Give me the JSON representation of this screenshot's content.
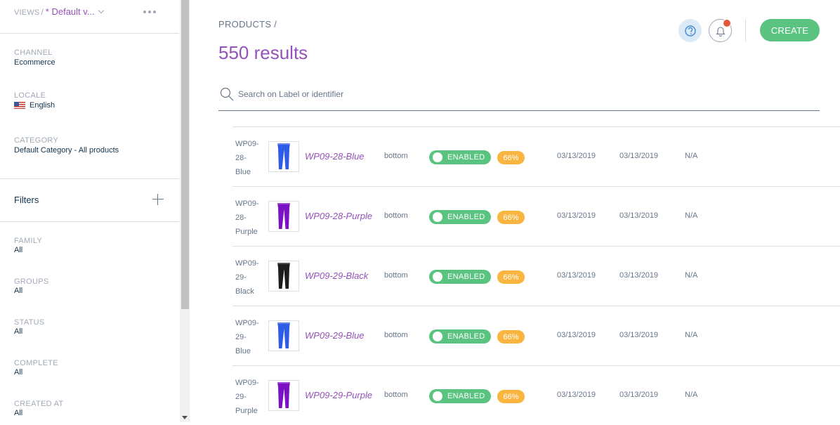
{
  "sidebar": {
    "views": {
      "label": "VIEWS",
      "separator": "/",
      "value": "* Default v..."
    },
    "context": [
      {
        "label": "CHANNEL",
        "value": "Ecommerce"
      },
      {
        "label": "LOCALE",
        "value": "English"
      },
      {
        "label": "CATEGORY",
        "value": "Default Category - All products"
      }
    ],
    "filters_title": "Filters",
    "filters": [
      {
        "label": "FAMILY",
        "value": "All"
      },
      {
        "label": "GROUPS",
        "value": "All"
      },
      {
        "label": "STATUS",
        "value": "All"
      },
      {
        "label": "COMPLETE",
        "value": "All"
      },
      {
        "label": "CREATED AT",
        "value": "All"
      }
    ]
  },
  "header": {
    "breadcrumb": "PRODUCTS /",
    "results": "550 results",
    "create_label": "CREATE"
  },
  "search": {
    "placeholder": "Search on Label or identifier"
  },
  "colors": {
    "accent": "#9452ba",
    "success": "#5ac380",
    "warning": "#f9b53f",
    "alert": "#e0583e"
  },
  "rows": [
    {
      "id_lines": [
        "WP09-",
        "28-",
        "Blue"
      ],
      "label": "WP09-28-Blue",
      "family": "bottom",
      "status": "ENABLED",
      "complete": "66%",
      "created": "03/13/2019",
      "updated": "03/13/2019",
      "variant": "N/A",
      "color": "#2f5ce6"
    },
    {
      "id_lines": [
        "WP09-",
        "28-",
        "Purple"
      ],
      "label": "WP09-28-Purple",
      "family": "bottom",
      "status": "ENABLED",
      "complete": "66%",
      "created": "03/13/2019",
      "updated": "03/13/2019",
      "variant": "N/A",
      "color": "#7a12c4"
    },
    {
      "id_lines": [
        "WP09-",
        "29-",
        "Black"
      ],
      "label": "WP09-29-Black",
      "family": "bottom",
      "status": "ENABLED",
      "complete": "66%",
      "created": "03/13/2019",
      "updated": "03/13/2019",
      "variant": "N/A",
      "color": "#1c1c1c"
    },
    {
      "id_lines": [
        "WP09-",
        "29-",
        "Blue"
      ],
      "label": "WP09-29-Blue",
      "family": "bottom",
      "status": "ENABLED",
      "complete": "66%",
      "created": "03/13/2019",
      "updated": "03/13/2019",
      "variant": "N/A",
      "color": "#2f5ce6"
    },
    {
      "id_lines": [
        "WP09-",
        "29-",
        "Purple"
      ],
      "label": "WP09-29-Purple",
      "family": "bottom",
      "status": "ENABLED",
      "complete": "66%",
      "created": "03/13/2019",
      "updated": "03/13/2019",
      "variant": "N/A",
      "color": "#7a12c4"
    }
  ]
}
